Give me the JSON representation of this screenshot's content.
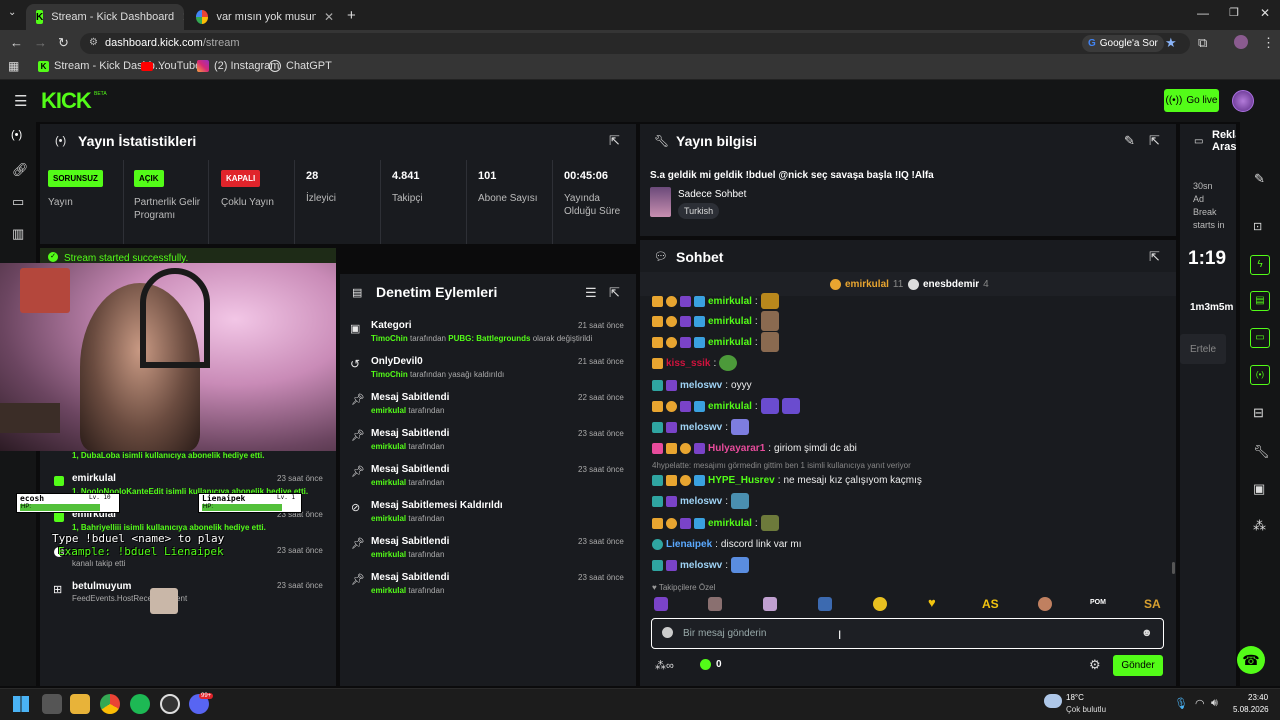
{
  "browser": {
    "tabs": [
      {
        "title": "Stream - Kick Dashboard",
        "close": "✕"
      },
      {
        "title": "var mısın yok musun kuzu - Go",
        "close": "✕"
      }
    ],
    "new_tab": "+",
    "url_host": "dashboard.kick.com",
    "url_path": "/stream",
    "google_button": "Google'a Sor",
    "bookmarks": [
      "Stream - Kick Dashb...",
      "YouTube",
      "(2) Instagram",
      "ChatGPT"
    ]
  },
  "kick": {
    "logo": "KICK",
    "logo_beta": "BETA",
    "go_live": "Go live"
  },
  "stats": {
    "title": "Yayın İstatistikleri",
    "items": [
      {
        "badge": "SORUNSUZ",
        "label": "Yayın",
        "badge_color": "#53fc18"
      },
      {
        "badge": "AÇIK",
        "label": "Partnerlik Gelir Programı",
        "badge_color": "#53fc18"
      },
      {
        "badge": "KAPALI",
        "label": "Çoklu Yayın",
        "badge_color": "#e0242b"
      },
      {
        "value": "28",
        "label": "İzleyici"
      },
      {
        "value": "4.841",
        "label": "Takipçi"
      },
      {
        "value": "101",
        "label": "Abone Sayısı"
      },
      {
        "value": "00:45:06",
        "label": "Yayında Olduğu Süre"
      }
    ],
    "success": "Stream started successfully."
  },
  "feed": {
    "rows": [
      {
        "name": "",
        "detail": "1, DubaLoba isimli kullanıcıya abonelik hediye etti.",
        "time": ""
      },
      {
        "name": "emirkulal",
        "detail": "1, NooloNooloKanteEdit isimli kullanıcıya abonelik hediye etti.",
        "time": "23 saat önce"
      },
      {
        "name": "emirkulal",
        "detail": "1, Bahriyelliii isimli kullanıcıya abonelik hediye etti.",
        "time": "23 saat önce"
      },
      {
        "name": "",
        "detail": "kanalı takip etti",
        "time": "23 saat önce"
      },
      {
        "name": "betulmuyum",
        "detail": "FeedEvents.HostReceivedEvent",
        "time": "23 saat önce"
      }
    ]
  },
  "overlay": {
    "player1": "ecosh",
    "player1_lv": "Lv. 10",
    "player2": "Lienaipek",
    "player2_lv": "Lv. 1",
    "hp": "HP:",
    "line1": "Type !bduel <name> to play",
    "line2": "Example: !bduel Lienaipek"
  },
  "moderation": {
    "title": "Denetim Eylemleri",
    "rows": [
      {
        "icon": "category-icon",
        "title": "Kategori",
        "user": "TimoChin",
        "rest": " tarafından ",
        "extra": "PUBG: Battlegrounds",
        "tail": " olarak değiştirildi",
        "time": "21 saat önce"
      },
      {
        "icon": "unban-icon",
        "title": "OnlyDevil0",
        "user": "TimoChin",
        "rest": " tarafından yasağı kaldırıldı",
        "extra": "",
        "tail": "",
        "time": "21 saat önce"
      },
      {
        "icon": "pin-icon",
        "title": "Mesaj Sabitlendi",
        "user": "emirkulal",
        "rest": " tarafından",
        "extra": "",
        "tail": "",
        "time": "22 saat önce"
      },
      {
        "icon": "pin-icon",
        "title": "Mesaj Sabitlendi",
        "user": "emirkulal",
        "rest": " tarafından",
        "extra": "",
        "tail": "",
        "time": "23 saat önce"
      },
      {
        "icon": "pin-icon",
        "title": "Mesaj Sabitlendi",
        "user": "emirkulal",
        "rest": " tarafından",
        "extra": "",
        "tail": "",
        "time": "23 saat önce"
      },
      {
        "icon": "unpin-icon",
        "title": "Mesaj Sabitlemesi Kaldırıldı",
        "user": "emirkulal",
        "rest": " tarafından",
        "extra": "",
        "tail": "",
        "time": "23 saat önce"
      },
      {
        "icon": "pin-icon",
        "title": "Mesaj Sabitlendi",
        "user": "emirkulal",
        "rest": " tarafından",
        "extra": "",
        "tail": "",
        "time": "23 saat önce"
      },
      {
        "icon": "pin-icon",
        "title": "Mesaj Sabitlendi",
        "user": "emirkulal",
        "rest": " tarafından",
        "extra": "",
        "tail": "",
        "time": "23 saat önce"
      }
    ]
  },
  "stream_info": {
    "title": "Yayın bilgisi",
    "stream_title": "S.a geldik mi geldik !bduel @nick seç savaşa başla !IQ !Alfa",
    "category": "Sadece Sohbet",
    "language": "Turkish"
  },
  "chat": {
    "title": "Sohbet",
    "gifters": [
      {
        "name": "emirkulal",
        "count": "11"
      },
      {
        "name": "enesbdemir",
        "count": "4"
      }
    ],
    "messages": [
      {
        "user": "emirkulal",
        "color": "#53fc18",
        "text": "",
        "emote": "#b8871c"
      },
      {
        "user": "emirkulal",
        "color": "#53fc18",
        "text": "",
        "emote": "#8a6a50"
      },
      {
        "user": "emirkulal",
        "color": "#53fc18",
        "text": "",
        "emote": "#8a6a50"
      },
      {
        "user": "kiss_ssik",
        "color": "#d1123d",
        "text": "",
        "emote": "#4c9a3a"
      },
      {
        "user": "meloswv",
        "color": "#9fd3f5",
        "text": "oyyy",
        "emote": ""
      },
      {
        "user": "emirkulal",
        "color": "#53fc18",
        "text": "",
        "emote": "#6a4ccf"
      },
      {
        "user": "meloswv",
        "color": "#9fd3f5",
        "text": "",
        "emote": "#7d7de0"
      },
      {
        "user": "Hulyayarar1",
        "color": "#e84c9c",
        "text": "giriom şimdi dc abi",
        "emote": ""
      },
      {
        "user": "HYPE_Husrev",
        "color": "#53fc18",
        "text": "ne mesajı kız çalışıyom kaçmış",
        "emote": ""
      },
      {
        "user": "meloswv",
        "color": "#9fd3f5",
        "text": "",
        "emote": "#4a8fb0"
      },
      {
        "user": "emirkulal",
        "color": "#53fc18",
        "text": "",
        "emote": "#6d7a3b"
      },
      {
        "user": "Lienaipek",
        "color": "#5aa9ff",
        "text": "discord link var mı",
        "emote": ""
      },
      {
        "user": "meloswv",
        "color": "#9fd3f5",
        "text": "",
        "emote": "#5a8de0"
      }
    ],
    "reply_context": "4hypelatte: mesajımı görmedin gittim ben 1 isimli kullanıcıya yanıt veriyor",
    "emote_bar_label": "Takipçilere Özel",
    "emote_texts": [
      "AS",
      "POM",
      "SA"
    ],
    "input_placeholder": "Bir mesaj gönderin",
    "infinity": "∞",
    "points": "0",
    "send": "Gönder"
  },
  "ad": {
    "title": "Reklam Arası",
    "text": "30sn Ad Break starts in",
    "countdown": "1:19",
    "next": "1m3m5m",
    "button": "Ertele"
  },
  "taskbar": {
    "weather_temp": "18°C",
    "weather_desc": "Çok bulutlu",
    "time": "23:40",
    "date": "5.08.2026",
    "badge": "99+"
  }
}
